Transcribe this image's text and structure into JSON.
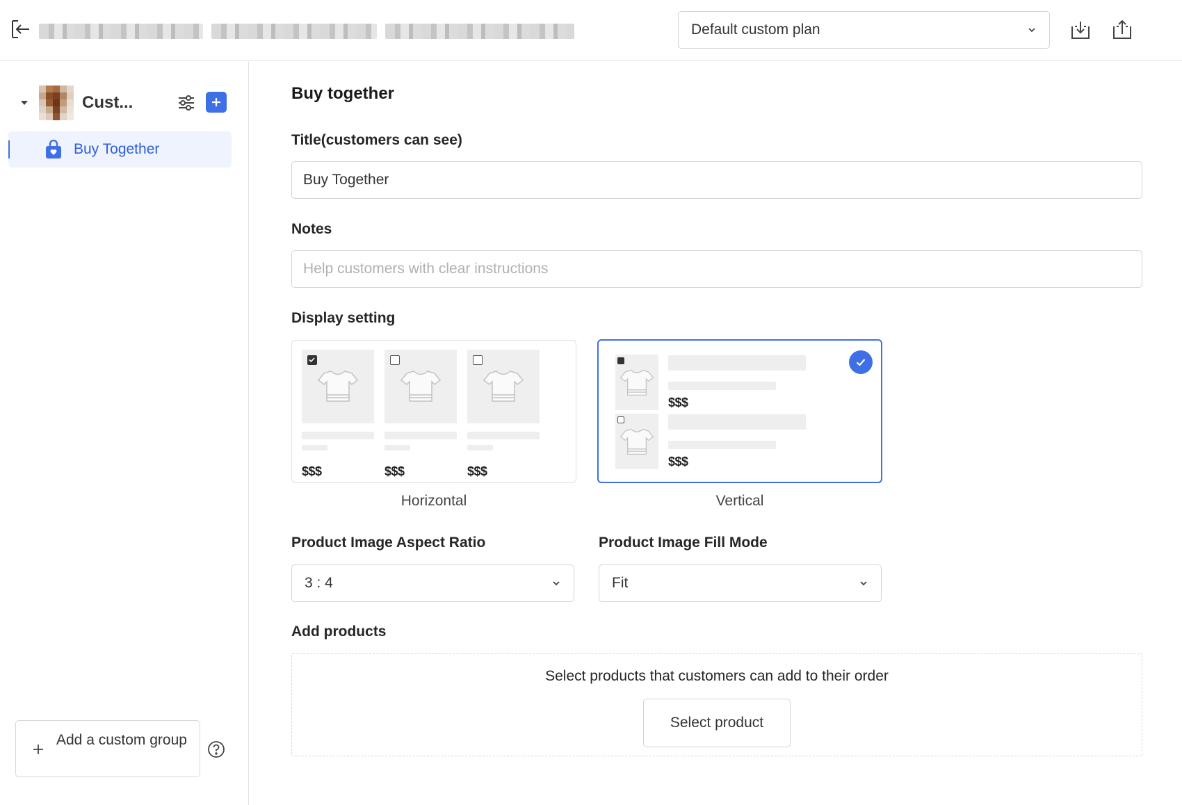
{
  "header": {
    "plan_select": {
      "value": "Default custom plan"
    }
  },
  "sidebar": {
    "group": {
      "name": "Cust..."
    },
    "items": [
      {
        "label": "Buy Together",
        "icon": "shopping-bag-icon",
        "active": true
      }
    ],
    "add_group_label": "Add a custom group"
  },
  "main": {
    "section_title": "Buy together",
    "title_field": {
      "label": "Title(customers can see)",
      "value": "Buy Together"
    },
    "notes_field": {
      "label": "Notes",
      "placeholder": "Help customers with clear instructions",
      "value": ""
    },
    "display_setting": {
      "label": "Display setting",
      "options": [
        {
          "caption": "Horizontal",
          "selected": false,
          "prices": [
            "$$$",
            "$$$",
            "$$$"
          ]
        },
        {
          "caption": "Vertical",
          "selected": true,
          "prices": [
            "$$$",
            "$$$"
          ]
        }
      ]
    },
    "aspect_ratio": {
      "label": "Product Image Aspect Ratio",
      "value": "3 : 4"
    },
    "fill_mode": {
      "label": "Product Image Fill Mode",
      "value": "Fit"
    },
    "add_products": {
      "label": "Add products",
      "hint": "Select products that customers can add to their order",
      "button_label": "Select product"
    }
  },
  "colors": {
    "accent": "#3f6fe6",
    "nav_active_bg": "#eef3fe",
    "border": "#d4d4d4"
  }
}
